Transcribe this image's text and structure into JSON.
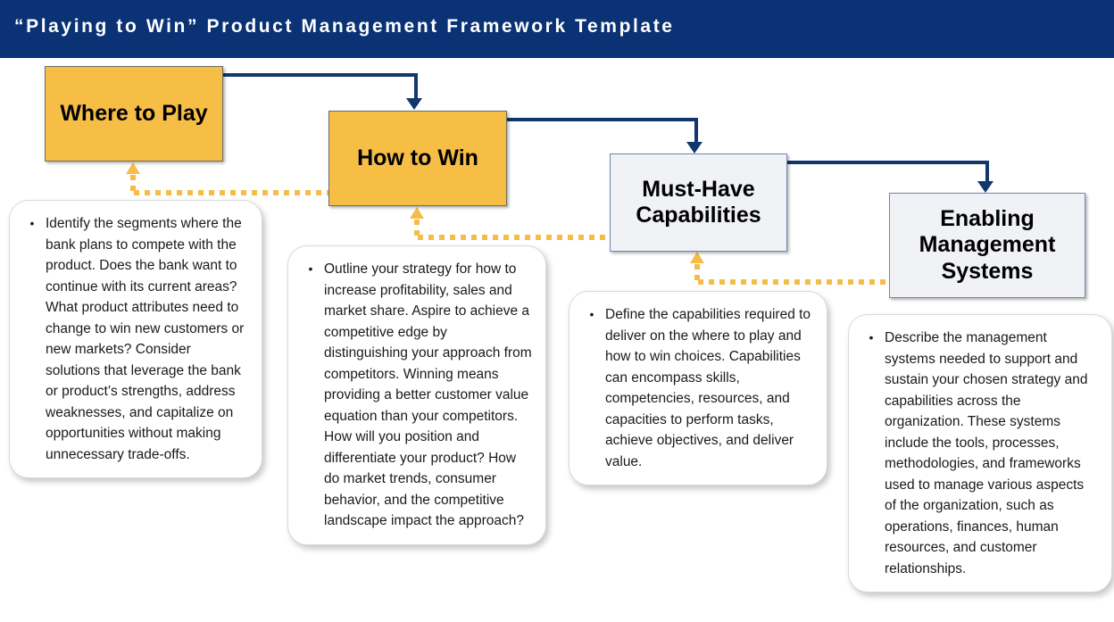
{
  "header": {
    "title": "“Playing to Win” Product Management Framework Template",
    "background_color": "#0a3274",
    "text_color": "#ffffff"
  },
  "colors": {
    "accent_amber": "#f7be46",
    "dotted_amber": "#f5bc4a",
    "navy_connector": "#12366e",
    "pale_box_fill": "#f0f2f6",
    "pale_box_border": "#6d88b4",
    "page_background": "#ffffff"
  },
  "stages": [
    {
      "id": "where-to-play",
      "label": "Where to Play",
      "style": "amber"
    },
    {
      "id": "how-to-win",
      "label": "How to Win",
      "style": "amber"
    },
    {
      "id": "must-have-capabilities",
      "label": "Must-Have Capabilities",
      "style": "pale"
    },
    {
      "id": "enabling-management-systems",
      "label": "Enabling Management Systems",
      "style": "pale"
    }
  ],
  "callouts": [
    {
      "id": "where-to-play-callout",
      "bullet": "•",
      "text": "Identify the segments where the bank plans to compete with the product. Does the bank want to continue with its current areas? What product attributes need to change to win new customers or new markets? Consider solutions that leverage the bank or product’s strengths, address weaknesses, and capitalize on opportunities without making unnecessary trade-offs."
    },
    {
      "id": "how-to-win-callout",
      "bullet": "•",
      "text": "Outline your strategy for how to increase profitability, sales and market share. Aspire to achieve a competitive edge by distinguishing your approach from competitors. Winning means providing a better customer value equation than your competitors. How will you position and differentiate your product? How do market trends, consumer behavior, and the competitive landscape impact the approach?"
    },
    {
      "id": "must-have-capabilities-callout",
      "bullet": "•",
      "text": "Define the capabilities required to deliver on the where to play and how to win choices. Capabilities can encompass skills, competencies, resources, and capacities to perform tasks, achieve objectives, and deliver value."
    },
    {
      "id": "enabling-management-systems-callout",
      "bullet": "•",
      "text": "Describe the management systems needed to support and sustain your chosen strategy and capabilities across the organization. These systems include the tools, processes, methodologies, and frameworks used to manage various aspects of the organization, such as operations, finances, human resources, and customer relationships."
    }
  ],
  "connectors": {
    "forward": [
      {
        "id": "where-to-how",
        "from": "Where to Play",
        "to": "How to Win",
        "style": "solid-navy-elbow-arrow"
      },
      {
        "id": "how-to-must",
        "from": "How to Win",
        "to": "Must-Have Capabilities",
        "style": "solid-navy-elbow-arrow"
      },
      {
        "id": "must-to-enabling",
        "from": "Must-Have Capabilities",
        "to": "Enabling Management Systems",
        "style": "solid-navy-elbow-arrow"
      }
    ],
    "feedback": [
      {
        "id": "how-to-where",
        "from": "How to Win",
        "to": "Where to Play",
        "style": "dotted-amber-elbow-arrow"
      },
      {
        "id": "must-to-how",
        "from": "Must-Have Capabilities",
        "to": "How to Win",
        "style": "dotted-amber-elbow-arrow"
      },
      {
        "id": "enabling-to-must",
        "from": "Enabling Management Systems",
        "to": "Must-Have Capabilities",
        "style": "dotted-amber-elbow-arrow"
      }
    ]
  }
}
